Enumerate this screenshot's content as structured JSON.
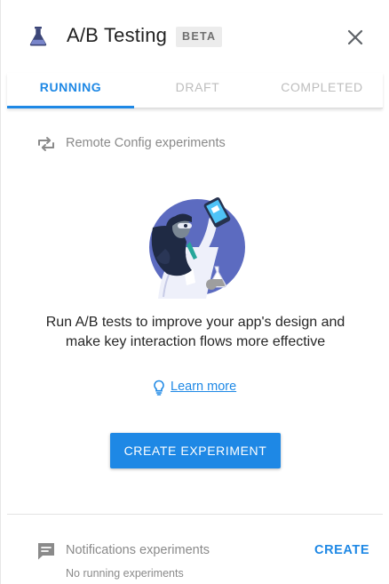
{
  "header": {
    "title": "A/B Testing",
    "badge": "BETA",
    "icon": "flask-icon",
    "close_icon": "close-icon"
  },
  "tabs": [
    {
      "label": "RUNNING",
      "active": true
    },
    {
      "label": "DRAFT",
      "active": false
    },
    {
      "label": "COMPLETED",
      "active": false
    }
  ],
  "remote_config": {
    "icon": "swap-arrows-icon",
    "label": "Remote Config experiments",
    "empty_message": "Run A/B tests to improve your app's design and make key interaction flows more effective",
    "learn_more": "Learn more",
    "learn_more_icon": "lightbulb-icon",
    "create_button": "CREATE EXPERIMENT"
  },
  "notifications": {
    "icon": "message-icon",
    "label": "Notifications experiments",
    "create_label": "CREATE",
    "status": "No running experiments"
  },
  "colors": {
    "accent": "#1e88e5",
    "illustration_circle": "#5c6bc0",
    "text_primary": "#212121",
    "text_secondary": "#8a8a8a"
  }
}
